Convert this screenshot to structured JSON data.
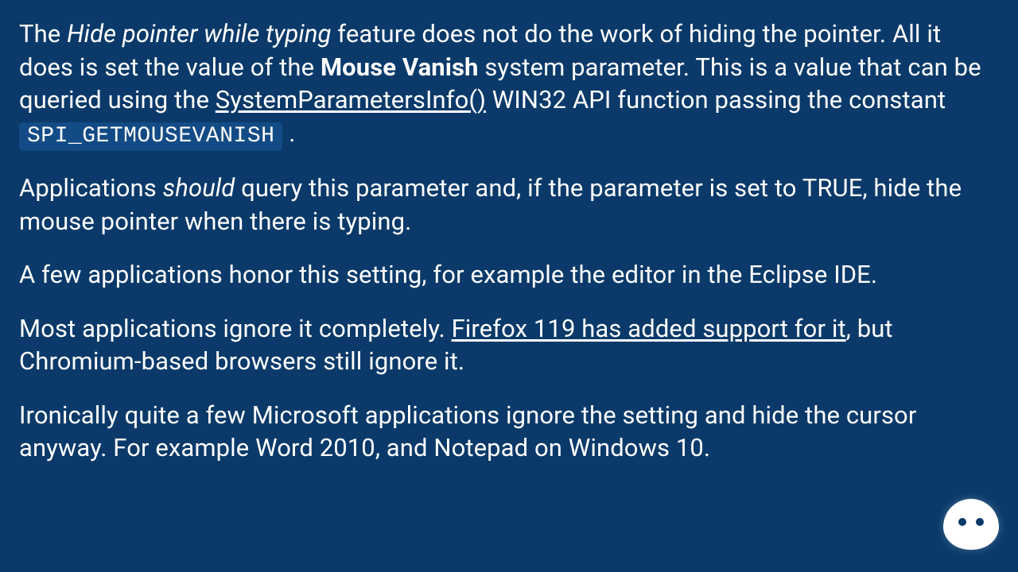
{
  "p1": {
    "s1": "The ",
    "feature_name": "Hide pointer while typing",
    "s2": " feature does not do the work of hiding the pointer. All it does is set the value of the ",
    "bold_term": "Mouse Vanish",
    "s3": " system parameter. This is a value that can be queried using the ",
    "link_text": "SystemParametersInfo()",
    "s4": " WIN32 API function passing the constant ",
    "code": "SPI_GETMOUSEVANISH",
    "s5": " ."
  },
  "p2": {
    "s1": "Applications ",
    "em": "should",
    "s2": " query this parameter and, if the parameter is set to TRUE, hide the mouse pointer when there is typing."
  },
  "p3": {
    "text": "A few applications honor this setting, for example the editor in the Eclipse IDE."
  },
  "p4": {
    "s1": "Most applications ignore it completely. ",
    "link_text": "Firefox 119 has added support for it",
    "s2": ", but Chromium-based browsers still ignore it."
  },
  "p5": {
    "text": "Ironically quite a few Microsoft applications ignore the setting and hide the cursor anyway. For example Word 2010, and Notepad on Windows 10."
  }
}
